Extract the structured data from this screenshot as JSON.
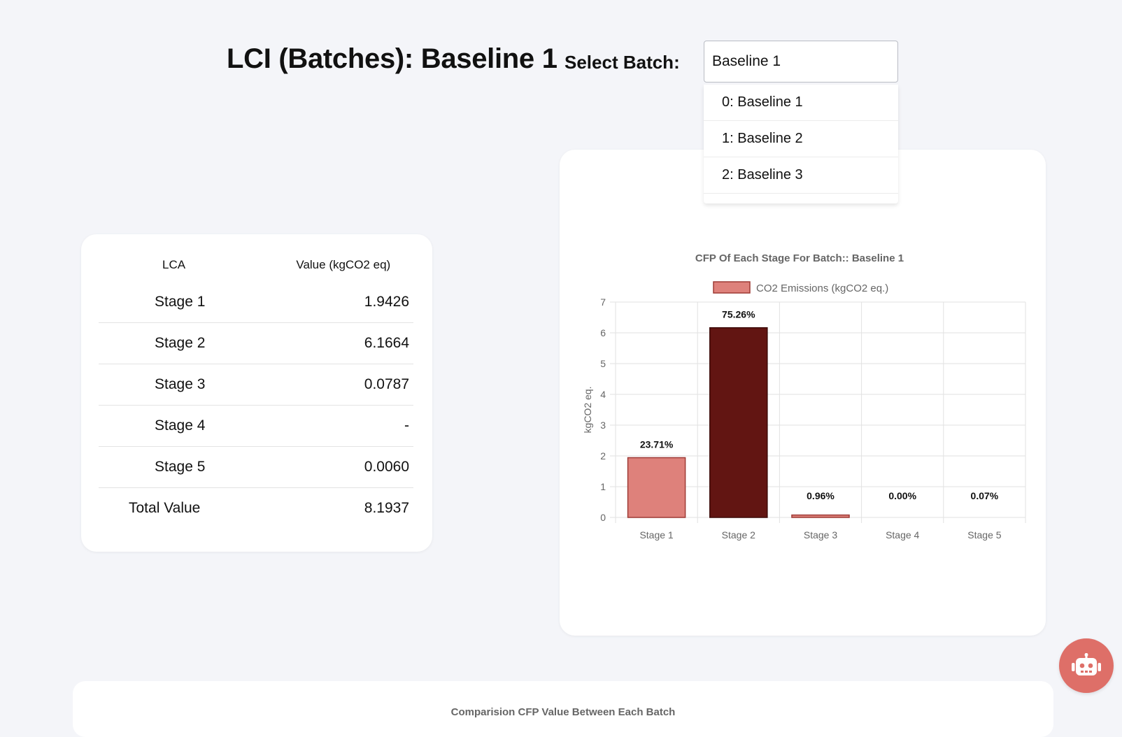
{
  "header": {
    "title": "LCI (Batches): Baseline 1",
    "select_label": "Select Batch:",
    "select_value": "Baseline 1"
  },
  "dropdown": {
    "options": [
      "0: Baseline 1",
      "1: Baseline 2",
      "2: Baseline 3"
    ]
  },
  "lca_table": {
    "headers": [
      "LCA",
      "Value (kgCO2 eq)"
    ],
    "rows": [
      {
        "label": "Stage 1",
        "value": "1.9426"
      },
      {
        "label": "Stage 2",
        "value": "6.1664"
      },
      {
        "label": "Stage 3",
        "value": "0.0787"
      },
      {
        "label": "Stage 4",
        "value": "-"
      },
      {
        "label": "Stage 5",
        "value": "0.0060"
      }
    ],
    "total": {
      "label": "Total Value",
      "value": "8.1937"
    }
  },
  "chart_data": {
    "type": "bar",
    "title": "CFP Of Each Stage For Batch:: Baseline 1",
    "categories": [
      "Stage 1",
      "Stage 2",
      "Stage 3",
      "Stage 4",
      "Stage 5"
    ],
    "series": [
      {
        "name": "CO2 Emissions (kgCO2 eq.)",
        "values": [
          1.9426,
          6.1664,
          0.0787,
          0,
          0.006
        ]
      }
    ],
    "data_labels": [
      "23.71%",
      "75.26%",
      "0.96%",
      "0.00%",
      "0.07%"
    ],
    "ylabel": "kgCO2 eq.",
    "xlabel": "",
    "ylim": [
      0,
      7
    ],
    "yticks": [
      0,
      1,
      2,
      3,
      4,
      5,
      6,
      7
    ],
    "grid": true,
    "legend_position": "top",
    "colors": {
      "default": "#de817b",
      "highlight": "#621512",
      "border": "#9e3a35"
    },
    "highlight_index": 1
  },
  "bottom_section": {
    "title": "Comparision CFP Value Between Each Batch"
  },
  "bot_button": {
    "icon": "robot-icon",
    "color": "#de6f68"
  }
}
